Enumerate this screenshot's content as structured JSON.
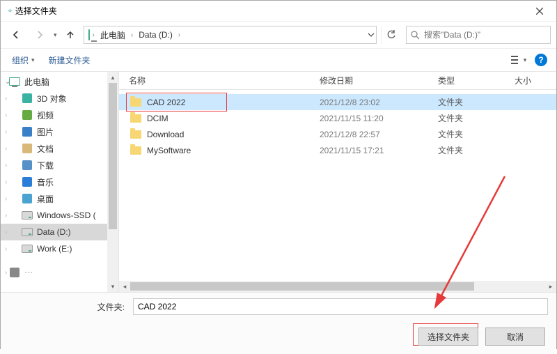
{
  "window": {
    "title": "选择文件夹"
  },
  "nav": {
    "path_root": "此电脑",
    "path_drive": "Data (D:)",
    "search_placeholder": "搜索\"Data (D:)\""
  },
  "toolbar": {
    "organize": "组织",
    "new_folder": "新建文件夹"
  },
  "sidebar": {
    "items": [
      {
        "label": "此电脑",
        "icon": "pc",
        "expandable": true
      },
      {
        "label": "3D 对象",
        "icon": "cube"
      },
      {
        "label": "视频",
        "icon": "video"
      },
      {
        "label": "图片",
        "icon": "picture"
      },
      {
        "label": "文档",
        "icon": "doc"
      },
      {
        "label": "下载",
        "icon": "download"
      },
      {
        "label": "音乐",
        "icon": "music"
      },
      {
        "label": "桌面",
        "icon": "desktop"
      },
      {
        "label": "Windows-SSD (",
        "icon": "drive"
      },
      {
        "label": "Data (D:)",
        "icon": "drive",
        "selected": true
      },
      {
        "label": "Work (E:)",
        "icon": "drive"
      }
    ]
  },
  "columns": {
    "name": "名称",
    "date": "修改日期",
    "type": "类型",
    "size": "大小"
  },
  "files": [
    {
      "name": "CAD 2022",
      "date": "2021/12/8 23:02",
      "type": "文件夹",
      "selected": true,
      "highlighted": true
    },
    {
      "name": "DCIM",
      "date": "2021/11/15 11:20",
      "type": "文件夹"
    },
    {
      "name": "Download",
      "date": "2021/12/8 22:57",
      "type": "文件夹"
    },
    {
      "name": "MySoftware",
      "date": "2021/11/15 17:21",
      "type": "文件夹"
    }
  ],
  "bottom": {
    "field_label": "文件夹:",
    "field_value": "CAD 2022",
    "select_button": "选择文件夹",
    "cancel_button": "取消"
  }
}
